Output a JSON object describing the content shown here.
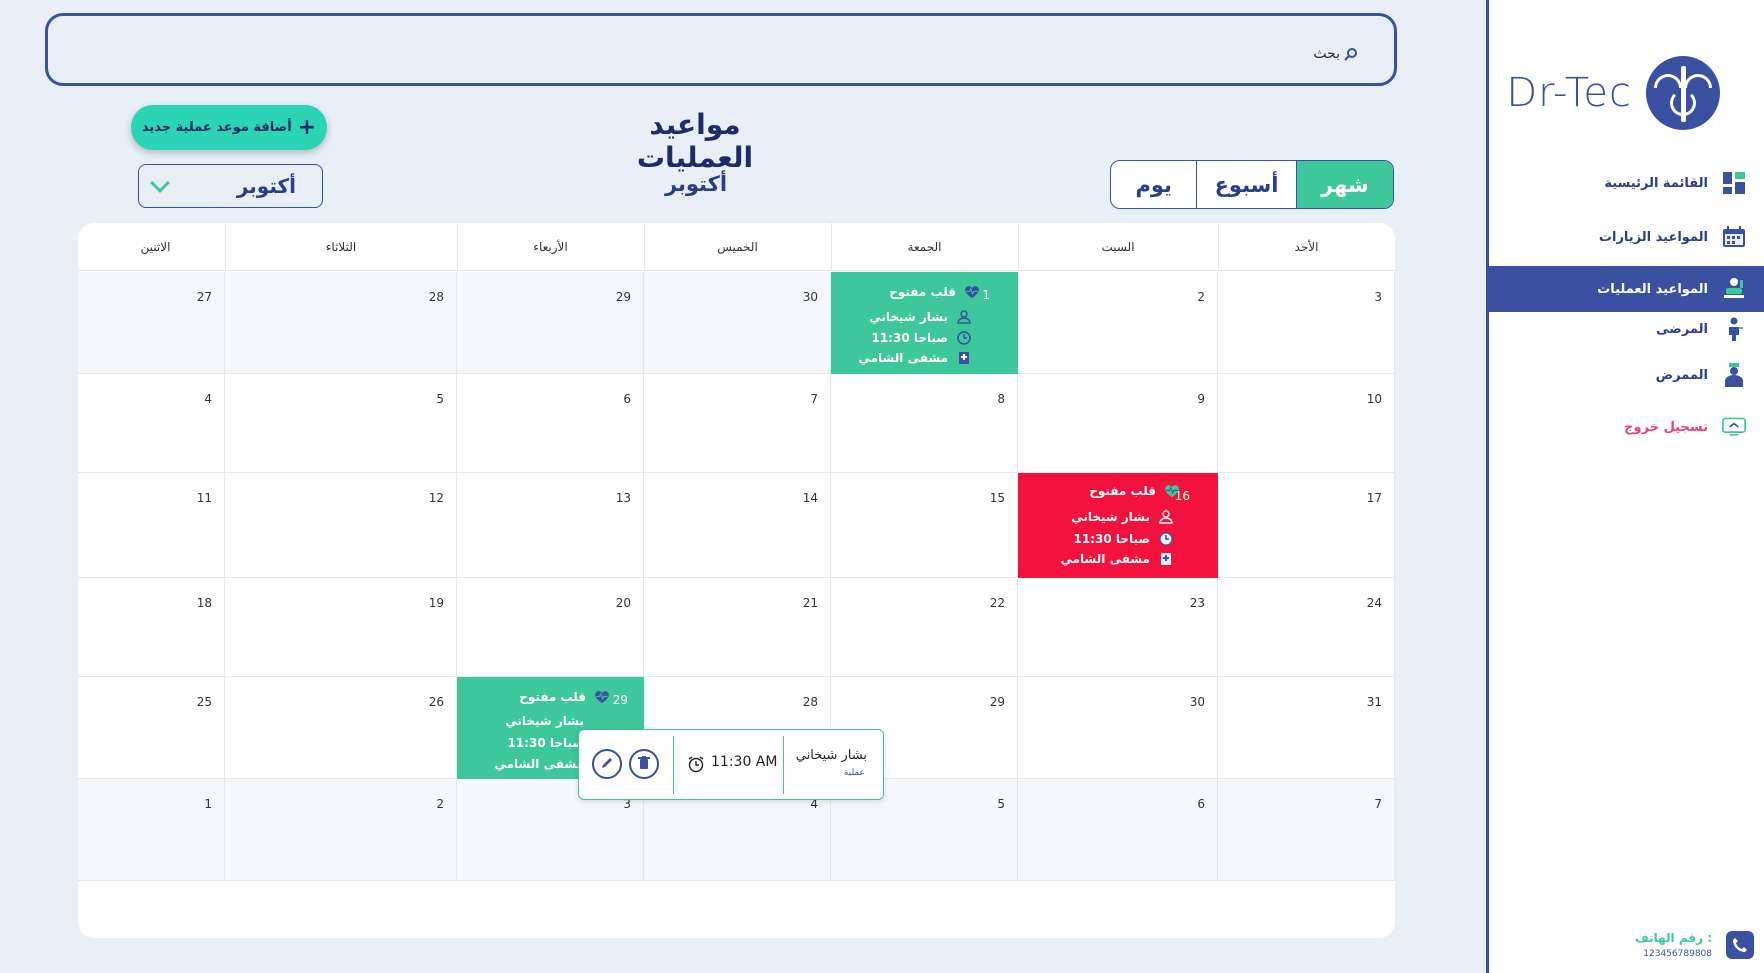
{
  "app": {
    "logo_text": "Dr-Tec"
  },
  "search": {
    "label": "بحث"
  },
  "sidebar": {
    "items": [
      {
        "label": "القائمة الرئيسية",
        "icon": "dashboard-icon"
      },
      {
        "label": "المواعيد الزيارات",
        "icon": "calendar-icon"
      },
      {
        "label": "المواعيد العمليات",
        "icon": "surgery-icon",
        "active": true
      },
      {
        "label": "المرضى",
        "icon": "patient-icon"
      },
      {
        "label": "الممرض",
        "icon": "nurse-icon"
      },
      {
        "label": "تسجيل خروج",
        "icon": "logout-icon"
      }
    ],
    "phone_label": "رقم الهاتف :",
    "phone_number": "123456789808"
  },
  "header": {
    "title": "مواعيد العمليات",
    "add_button": "أضافة موعد عملية جديد",
    "month_label": "أكتوبر",
    "month_select": "أكتوبر",
    "views": {
      "month": "شهر",
      "week": "أسبوع",
      "day": "يوم"
    }
  },
  "calendar": {
    "weekdays": [
      "الأحد",
      "السبت",
      "الجمعة",
      "الخميس",
      "الأربعاء",
      "الثلاثاء",
      "الاثنين"
    ],
    "weeks": [
      [
        "3",
        "2",
        "1",
        "30",
        "29",
        "28",
        "27"
      ],
      [
        "10",
        "9",
        "8",
        "7",
        "6",
        "5",
        "4"
      ],
      [
        "17",
        "16",
        "15",
        "14",
        "13",
        "12",
        "11"
      ],
      [
        "24",
        "23",
        "22",
        "21",
        "20",
        "19",
        "18"
      ],
      [
        "31",
        "30",
        "29",
        "28",
        "29",
        "26",
        "25"
      ],
      [
        "7",
        "6",
        "5",
        "4",
        "3",
        "2",
        "1"
      ]
    ],
    "events": [
      {
        "day": "1",
        "title": "قلب مفتوح",
        "patient": "بشار شيخاني",
        "time": "11:30 صباحا",
        "place": "مشفى الشامي",
        "color": "#3ec79a"
      },
      {
        "day": "16",
        "title": "قلب مفتوح",
        "patient": "بشار شيخاني",
        "time": "11:30 صباحا",
        "place": "مشفى الشامي",
        "color": "#f2123d"
      },
      {
        "day": "29",
        "title": "قلب مفتوح",
        "patient": "بشار شيخاني",
        "time": "11:30 صباحا",
        "place": "مشفى الشامي",
        "color": "#3ec79a"
      }
    ]
  },
  "popup": {
    "name": "بشار شيخاني",
    "type": "عملية",
    "time": "11:30 AM"
  },
  "colors": {
    "primary": "#3a50a0",
    "accent": "#3ec79a",
    "danger": "#f2123d",
    "add_button": "#2bd4b5"
  }
}
